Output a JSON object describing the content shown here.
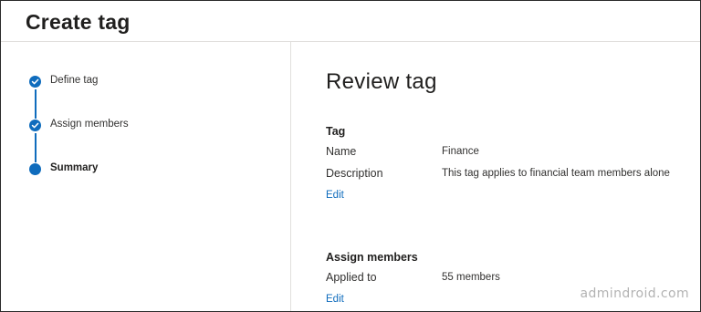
{
  "header": {
    "title": "Create tag"
  },
  "steps": [
    {
      "label": "Define tag",
      "state": "completed"
    },
    {
      "label": "Assign members",
      "state": "completed"
    },
    {
      "label": "Summary",
      "state": "current"
    }
  ],
  "main": {
    "title": "Review tag",
    "tag_section": {
      "title": "Tag",
      "name_label": "Name",
      "name_value": "Finance",
      "description_label": "Description",
      "description_value": "This tag applies to financial team members alone",
      "edit_label": "Edit"
    },
    "members_section": {
      "title": "Assign members",
      "applied_label": "Applied to",
      "applied_value": "55 members",
      "edit_label": "Edit"
    }
  },
  "watermark": "admindroid.com",
  "colors": {
    "accent": "#0f6cbd",
    "border": "#e1dfdd",
    "text": "#323130"
  },
  "icons": {
    "completed_step": "checkmark-icon",
    "current_step": "dot-icon"
  }
}
